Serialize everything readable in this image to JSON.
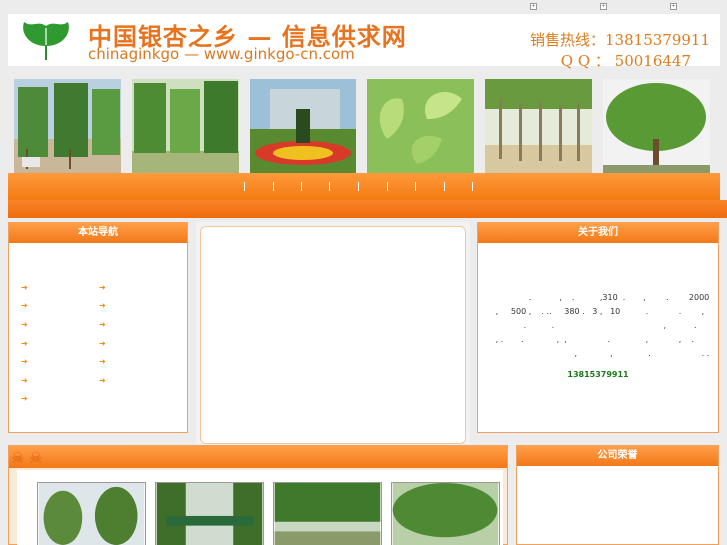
{
  "header": {
    "title_cn": "中国银杏之乡 — 信息供求网",
    "title_en": "chinaginkgo — www.ginkgo-cn.com",
    "hotline": "销售热线：13815379911",
    "qq": "Q  Q ：  50016447"
  },
  "top_icons": [
    "+",
    "+",
    "+"
  ],
  "photos": [
    {
      "name": "ginkgo-trees-road-photo"
    },
    {
      "name": "ginkgo-trees-field-photo"
    },
    {
      "name": "flower-garden-photo"
    },
    {
      "name": "ginkgo-leaves-photo"
    },
    {
      "name": "ginkgo-saplings-photo"
    },
    {
      "name": "ginkgo-large-tree-photo"
    }
  ],
  "nav_panel": {
    "title": "本站导航"
  },
  "about_panel": {
    "title": "关于我们",
    "lines": [
      "                .           ,    .          ,310  .       ,        .        2000",
      "   ,     500 ,    . ..     380 .   3 ,   10          .            .        ,",
      "              .          .                                           ,           .",
      "   , .       .             ,  ,                .              ,            ,    .",
      "                                  ,             ,              .                    . ."
    ],
    "phone": "13815379911"
  },
  "honor_panel": {
    "title": "公司荣誉"
  },
  "colors": {
    "accent": "#f47a10",
    "brand_text": "#e8731e",
    "phone_green": "#1a7a1a"
  }
}
